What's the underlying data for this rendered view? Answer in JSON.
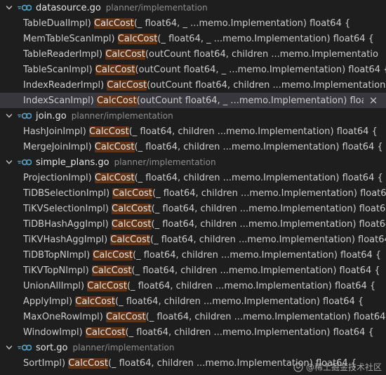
{
  "files": [
    {
      "name": "datasource.go",
      "path": "planner/implementation",
      "matches": [
        {
          "before": "TableDualImpl) ",
          "match": "CalcCost",
          "after": "(_ float64, _ ...memo.Implementation) float64 {"
        },
        {
          "before": "MemTableScanImpl) ",
          "match": "CalcCost",
          "after": "(_ float64, _ ...memo.Implementation) float64 {"
        },
        {
          "before": "TableReaderImpl) ",
          "match": "CalcCost",
          "after": "(outCount float64, children ...memo.Implementatio"
        },
        {
          "before": "TableScanImpl) ",
          "match": "CalcCost",
          "after": "(outCount float64, _ ...memo.Implementation) float64 {"
        },
        {
          "before": "IndexReaderImpl) ",
          "match": "CalcCost",
          "after": "(outCount float64, children ...memo.Implementation) float64 {"
        },
        {
          "before": "IndexScanImpl) ",
          "match": "CalcCost",
          "after": "(outCount float64, _ ...memo.Implementation) float64 {"
        }
      ]
    },
    {
      "name": "join.go",
      "path": "planner/implementation",
      "matches": [
        {
          "before": "HashJoinImpl) ",
          "match": "CalcCost",
          "after": "(_ float64, children ...memo.Implementation) float64 {"
        },
        {
          "before": "MergeJoinImpl) ",
          "match": "CalcCost",
          "after": "(_ float64, children ...memo.Implementation) float64 {"
        }
      ]
    },
    {
      "name": "simple_plans.go",
      "path": "planner/implementation",
      "matches": [
        {
          "before": "ProjectionImpl) ",
          "match": "CalcCost",
          "after": "(_ float64, children ...memo.Implementation) float64 {"
        },
        {
          "before": "TiDBSelectionImpl) ",
          "match": "CalcCost",
          "after": "(_ float64, children ...memo.Implementation) float64 {"
        },
        {
          "before": "TiKVSelectionImpl) ",
          "match": "CalcCost",
          "after": "(_ float64, children ...memo.Implementation) float64 {"
        },
        {
          "before": "TiDBHashAggImpl) ",
          "match": "CalcCost",
          "after": "(_ float64, children ...memo.Implementation) float64 {"
        },
        {
          "before": "TiKVHashAggImpl) ",
          "match": "CalcCost",
          "after": "(_ float64, children ...memo.Implementation) float64 {"
        },
        {
          "before": "TiDBTopNImpl) ",
          "match": "CalcCost",
          "after": "(_ float64, children ...memo.Implementation) float64 {"
        },
        {
          "before": "TiKVTopNImpl) ",
          "match": "CalcCost",
          "after": "(_ float64, children ...memo.Implementation) float64 {"
        },
        {
          "before": "UnionAllImpl) ",
          "match": "CalcCost",
          "after": "(_ float64, children ...memo.Implementation) float64 {"
        },
        {
          "before": "ApplyImpl) ",
          "match": "CalcCost",
          "after": "(_ float64, children ...memo.Implementation) float64 {"
        },
        {
          "before": "MaxOneRowImpl) ",
          "match": "CalcCost",
          "after": "(_ float64, children ...memo.Implementation) float64 {"
        },
        {
          "before": "WindowImpl) ",
          "match": "CalcCost",
          "after": "(_ float64, children ...memo.Implementation) float64 {"
        }
      ]
    },
    {
      "name": "sort.go",
      "path": "planner/implementation",
      "matches": [
        {
          "before": "SortImpl) ",
          "match": "CalcCost",
          "after": "(_ float64, children ...memo.Implementation) float64 {"
        }
      ]
    }
  ],
  "selected": {
    "file": 0,
    "match": 5
  },
  "colors": {
    "background": "#1e1e1e",
    "match_highlight": "#613214",
    "selected_row": "#37373d",
    "go_icon": "#519aba"
  },
  "icons": {
    "chevron": "chevron-down-icon",
    "file": "go-file-icon",
    "close": "close-icon"
  },
  "watermark": "@稀土掘金技术社区"
}
